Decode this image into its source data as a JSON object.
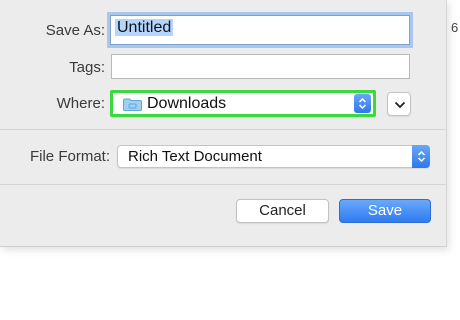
{
  "dialog": {
    "save_as_label": "Save As:",
    "save_as_value": "Untitled",
    "tags_label": "Tags:",
    "tags_value": "",
    "where_label": "Where:",
    "where_value": "Downloads",
    "file_format_label": "File Format:",
    "file_format_value": "Rich Text Document",
    "cancel_label": "Cancel",
    "save_label": "Save",
    "highlight_color": "#3bd93b",
    "accent_color": "#2f7bf0"
  },
  "background_edge_text": "6",
  "icons": {
    "where_folder": "folder-icon",
    "where_stepper": "up-down-chevron-icon",
    "expand": "chevron-down-icon",
    "format_stepper": "up-down-chevron-icon"
  }
}
